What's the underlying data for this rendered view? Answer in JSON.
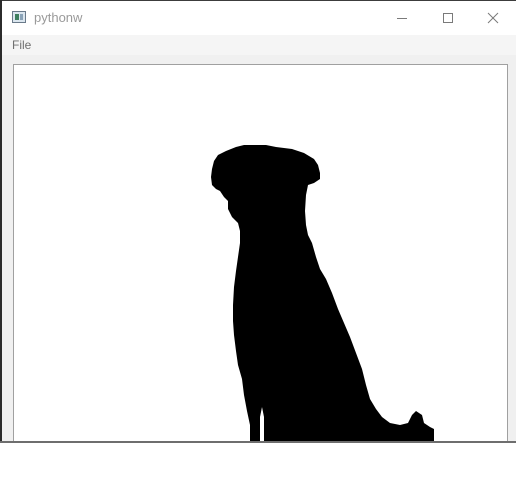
{
  "window": {
    "title": "pythonw",
    "icon": "python-window-icon",
    "controls": {
      "minimize": "minimize-icon",
      "maximize": "maximize-icon",
      "close": "close-icon"
    }
  },
  "menubar": {
    "items": [
      {
        "label": "File"
      }
    ]
  },
  "canvas": {
    "content": "silhouette-image",
    "foreground_color": "#000000",
    "background_color": "#ffffff"
  }
}
